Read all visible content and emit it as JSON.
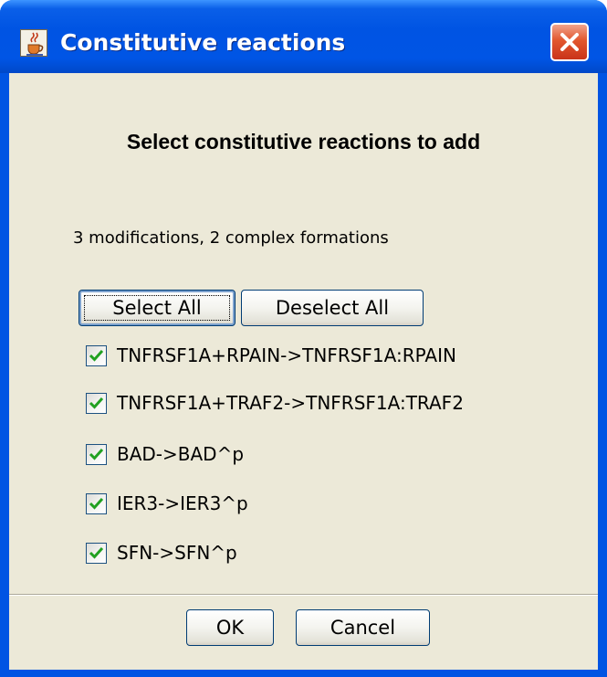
{
  "window": {
    "title": "Constitutive reactions",
    "icon": "java-cup-icon",
    "close_icon": "close-icon"
  },
  "dialog": {
    "heading": "Select constitutive reactions to add",
    "summary": "3 modifications, 2 complex formations",
    "select_all_label": "Select All",
    "deselect_all_label": "Deselect All",
    "reactions": [
      {
        "label": "TNFRSF1A+RPAIN->TNFRSF1A:RPAIN",
        "checked": true
      },
      {
        "label": "TNFRSF1A+TRAF2->TNFRSF1A:TRAF2",
        "checked": true
      },
      {
        "label": "BAD->BAD^p",
        "checked": true
      },
      {
        "label": "IER3->IER3^p",
        "checked": true
      },
      {
        "label": "SFN->SFN^p",
        "checked": true
      }
    ],
    "ok_label": "OK",
    "cancel_label": "Cancel"
  },
  "colors": {
    "titlebar": "#0054e3",
    "dialog_background": "#ece9d8",
    "close_button": "#e2572f",
    "checkmark": "#21a121"
  }
}
